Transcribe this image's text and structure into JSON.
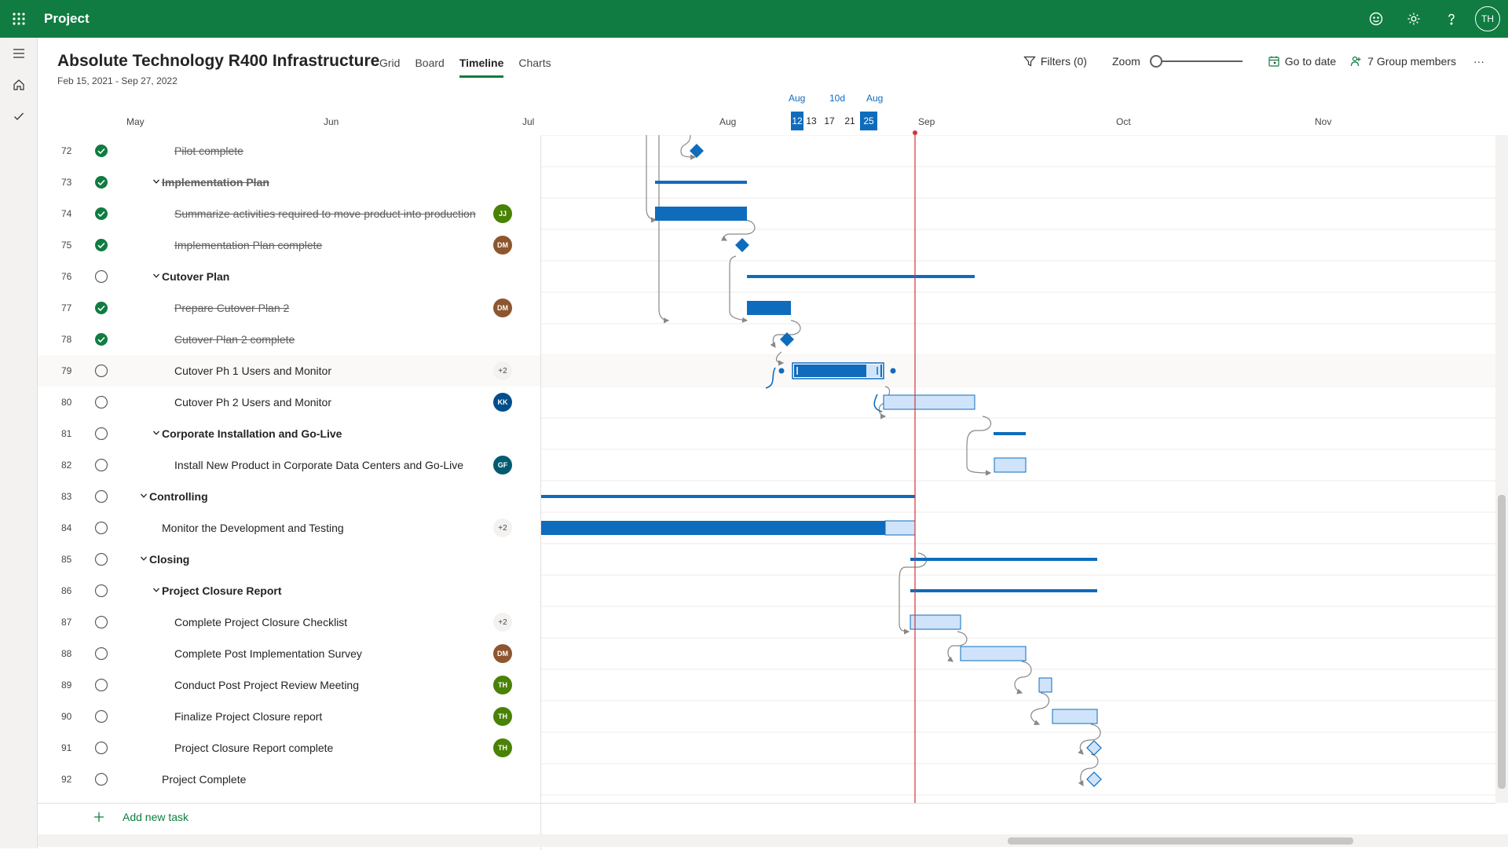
{
  "topbar": {
    "app_name": "Project",
    "user_initials": "TH",
    "color": "#107c41"
  },
  "project": {
    "title": "Absolute Technology R400 Infrastructure",
    "dates": "Feb 15, 2021 - Sep 27, 2022"
  },
  "tabs": [
    "Grid",
    "Board",
    "Timeline",
    "Charts"
  ],
  "active_tab": "Timeline",
  "toolbar": {
    "filters_label": "Filters (0)",
    "zoom_label": "Zoom",
    "go_to_date_label": "Go to date",
    "members_label": "7 Group members",
    "more_label": "···"
  },
  "timeline_header": {
    "months": [
      "May",
      "Jun",
      "Jul",
      "Aug",
      "Sep",
      "Oct",
      "Nov"
    ],
    "selection_start_month": "Aug",
    "selection_duration": "10d",
    "selection_end_month": "Aug",
    "days": [
      "12",
      "13",
      "17",
      "21",
      "25"
    ]
  },
  "tasks": [
    {
      "num": "72",
      "name": "Pilot complete",
      "done": true,
      "indent": 2,
      "summary": false,
      "assignee": ""
    },
    {
      "num": "73",
      "name": "Implementation Plan",
      "done": true,
      "indent": 1,
      "summary": true,
      "assignee": ""
    },
    {
      "num": "74",
      "name": "Summarize activities required to move product into production",
      "done": true,
      "indent": 2,
      "summary": false,
      "assignee": "JJ"
    },
    {
      "num": "75",
      "name": "Implementation Plan complete",
      "done": true,
      "indent": 2,
      "summary": false,
      "assignee": "DM"
    },
    {
      "num": "76",
      "name": "Cutover Plan",
      "done": false,
      "indent": 1,
      "summary": true,
      "assignee": ""
    },
    {
      "num": "77",
      "name": "Prepare Cutover Plan 2",
      "done": true,
      "indent": 2,
      "summary": false,
      "assignee": "DM"
    },
    {
      "num": "78",
      "name": "Cutover Plan 2 complete",
      "done": true,
      "indent": 2,
      "summary": false,
      "assignee": ""
    },
    {
      "num": "79",
      "name": "Cutover Ph 1 Users and Monitor",
      "done": false,
      "indent": 2,
      "summary": false,
      "assignee": "+2"
    },
    {
      "num": "80",
      "name": "Cutover Ph 2 Users and Monitor",
      "done": false,
      "indent": 2,
      "summary": false,
      "assignee": "KK"
    },
    {
      "num": "81",
      "name": "Corporate Installation and Go-Live",
      "done": false,
      "indent": 1,
      "summary": true,
      "assignee": ""
    },
    {
      "num": "82",
      "name": "Install New Product in Corporate Data Centers and Go-Live",
      "done": false,
      "indent": 2,
      "summary": false,
      "assignee": "GF"
    },
    {
      "num": "83",
      "name": "Controlling",
      "done": false,
      "indent": 0,
      "summary": true,
      "assignee": ""
    },
    {
      "num": "84",
      "name": "Monitor the Development and Testing",
      "done": false,
      "indent": 1,
      "summary": false,
      "assignee": "+2"
    },
    {
      "num": "85",
      "name": "Closing",
      "done": false,
      "indent": 0,
      "summary": true,
      "assignee": ""
    },
    {
      "num": "86",
      "name": "Project Closure Report",
      "done": false,
      "indent": 1,
      "summary": true,
      "assignee": ""
    },
    {
      "num": "87",
      "name": "Complete Project Closure Checklist",
      "done": false,
      "indent": 2,
      "summary": false,
      "assignee": "+2"
    },
    {
      "num": "88",
      "name": "Complete Post Implementation Survey",
      "done": false,
      "indent": 2,
      "summary": false,
      "assignee": "DM"
    },
    {
      "num": "89",
      "name": "Conduct Post Project Review Meeting",
      "done": false,
      "indent": 2,
      "summary": false,
      "assignee": "TH"
    },
    {
      "num": "90",
      "name": "Finalize Project Closure report",
      "done": false,
      "indent": 2,
      "summary": false,
      "assignee": "TH"
    },
    {
      "num": "91",
      "name": "Project Closure Report complete",
      "done": false,
      "indent": 2,
      "summary": false,
      "assignee": "TH"
    },
    {
      "num": "92",
      "name": "Project Complete",
      "done": false,
      "indent": 1,
      "summary": false,
      "assignee": ""
    }
  ],
  "assignee_colors": {
    "JJ": "#498205",
    "DM": "#8e562e",
    "KK": "#004e8c",
    "GF": "#005b70",
    "TH": "#498205"
  },
  "add_task_label": "Add new task"
}
